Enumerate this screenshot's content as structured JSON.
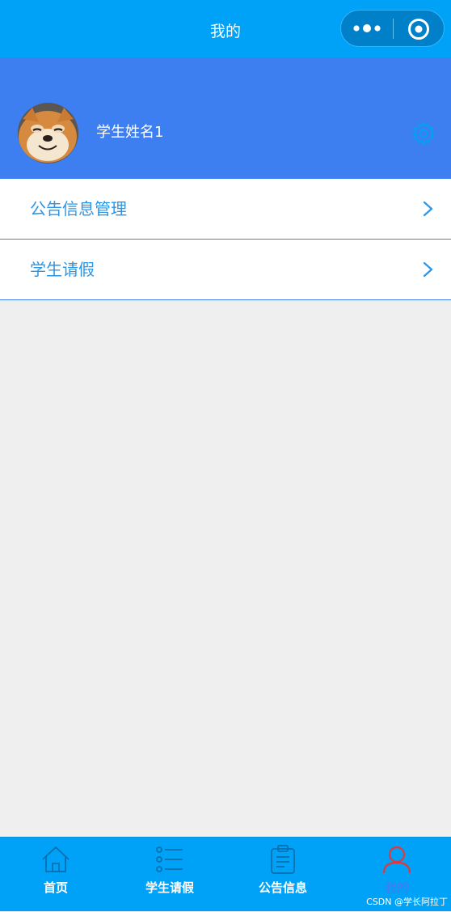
{
  "colors": {
    "nav_bg": "#00a2f8",
    "profile_bg": "#3d7ef0",
    "page_bg": "#efefef",
    "menu_text": "#2b95e6",
    "tab_active": "#3d7ef0",
    "active_icon": "#e0383e"
  },
  "navbar": {
    "title": "我的"
  },
  "profile": {
    "name": "学生姓名1"
  },
  "menu": [
    {
      "label": "公告信息管理"
    },
    {
      "label": "学生请假"
    }
  ],
  "tabbar": {
    "tabs": [
      {
        "label": "首页",
        "icon": "home-icon"
      },
      {
        "label": "学生请假",
        "icon": "list-icon"
      },
      {
        "label": "公告信息",
        "icon": "clipboard-icon"
      },
      {
        "label": "我的",
        "icon": "user-icon"
      }
    ],
    "active_index": 3
  },
  "watermark": "CSDN @学长阿拉丁"
}
